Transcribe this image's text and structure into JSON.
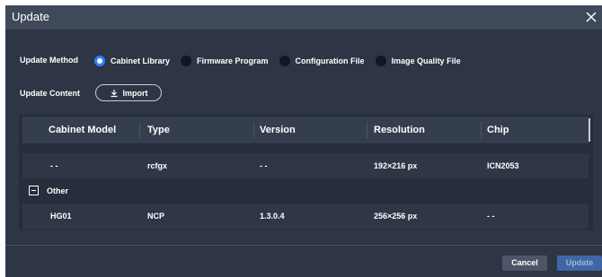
{
  "dialog": {
    "title": "Update",
    "close_icon": "close-icon"
  },
  "update_method": {
    "label": "Update Method",
    "options": [
      {
        "label": "Cabinet Library",
        "checked": true
      },
      {
        "label": "Firmware Program",
        "checked": false
      },
      {
        "label": "Configuration File",
        "checked": false
      },
      {
        "label": "Image Quality File",
        "checked": false
      }
    ]
  },
  "update_content": {
    "label": "Update Content",
    "import_label": "Import",
    "import_icon": "import-icon"
  },
  "table": {
    "columns": [
      "Cabinet Model",
      "Type",
      "Version",
      "Resolution",
      "Chip"
    ],
    "rows": [
      {
        "model": "- -",
        "type": "rcfgx",
        "version": "- -",
        "resolution": "192×216 px",
        "chip": "ICN2053"
      },
      {
        "model": "HG01",
        "type": "NCP",
        "version": "1.3.0.4",
        "resolution": "256×256 px",
        "chip": "- -"
      }
    ],
    "group": {
      "label": "Other",
      "expanded": true
    }
  },
  "footer": {
    "cancel_label": "Cancel",
    "update_label": "Update"
  },
  "colors": {
    "background": "#2e3545",
    "titlebar": "#3f495a",
    "accent": "#2e7fff",
    "update_button": "#3f67a8"
  }
}
